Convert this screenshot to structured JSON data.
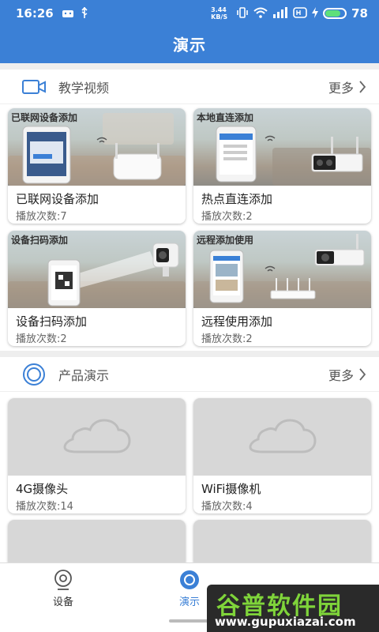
{
  "status_bar": {
    "time": "16:26",
    "net_speed": "3.44 KB/S",
    "battery": "78",
    "battery_level": 0.78
  },
  "header": {
    "title": "演示"
  },
  "tutorial": {
    "title": "教学视频",
    "more": "更多",
    "cards": [
      {
        "caption": "已联网设备添加",
        "name": "已联网设备添加",
        "plays": "播放次数:7"
      },
      {
        "caption": "本地直连添加",
        "name": "热点直连添加",
        "plays": "播放次数:2"
      },
      {
        "caption": "设备扫码添加",
        "name": "设备扫码添加",
        "plays": "播放次数:2"
      },
      {
        "caption": "远程添加使用",
        "name": "远程使用添加",
        "plays": "播放次数:2"
      }
    ]
  },
  "products": {
    "title": "产品演示",
    "more": "更多",
    "cards": [
      {
        "name": "4G摄像头",
        "plays": "播放次数:14"
      },
      {
        "name": "WiFi摄像机",
        "plays": "播放次数:4"
      }
    ]
  },
  "tabbar": {
    "tabs": [
      {
        "label": "设备"
      },
      {
        "label": "演示"
      }
    ]
  },
  "watermark": {
    "title": "谷普软件园",
    "url": "www.gupuxiazai.com"
  },
  "colors": {
    "primary": "#3b80d6",
    "battery": "#5ee07a"
  }
}
